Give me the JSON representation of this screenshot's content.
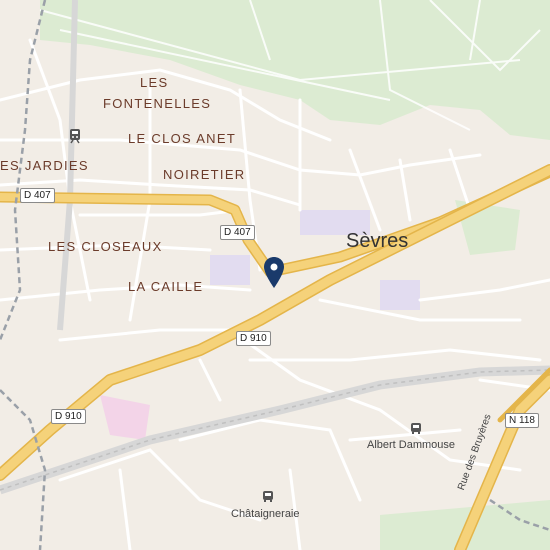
{
  "map": {
    "colors": {
      "land": "#f2ede6",
      "park": "#dcebd2",
      "highway": "#f5d27a",
      "highway_casing": "#e4b54a",
      "street": "#ffffff",
      "rail": "#c9c9c9",
      "boundary": "#9aa0a8",
      "marker": "#1a3a6b",
      "school": "#e2dcf0",
      "hospital": "#f3d4e8"
    },
    "city": "Sèvres",
    "areas": [
      "LES",
      "FONTENELLES",
      "LE CLOS ANET",
      "NOIRETIER",
      "ES JARDIES",
      "LES CLOSEAUX",
      "LA CAILLE"
    ],
    "shields": {
      "d407_west": "D 407",
      "d407_center": "D 407",
      "d910_center": "D 910",
      "d910_west": "D 910",
      "n118": "N 118"
    },
    "stations": {
      "albert": "Albert Dammouse",
      "chataigneraie": "Châtaigneraie"
    },
    "street": "Rue des Bruyères",
    "icons": {
      "marker": "map-pin-icon",
      "station": "bus-stop-icon",
      "train": "train-station-icon"
    }
  }
}
